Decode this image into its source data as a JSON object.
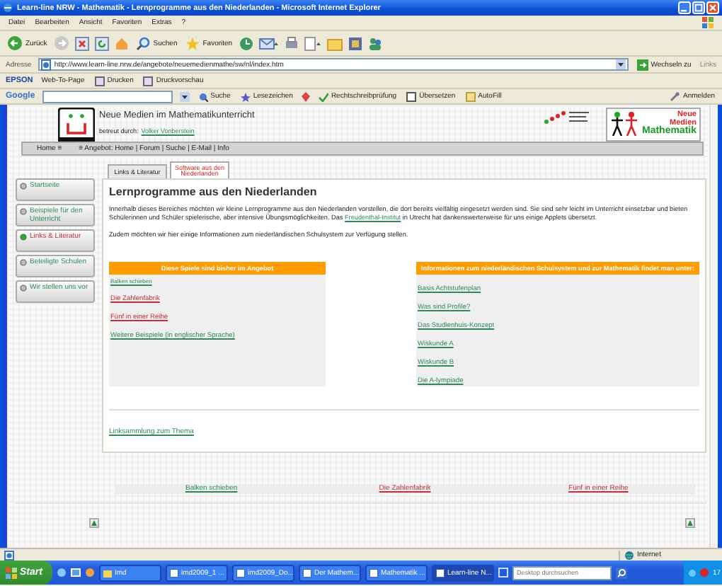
{
  "window": {
    "title": "Learn-line NRW - Mathematik - Lernprogramme aus den Niederlanden - Microsoft Internet Explorer"
  },
  "menu": [
    "Datei",
    "Bearbeiten",
    "Ansicht",
    "Favoriten",
    "Extras",
    "?"
  ],
  "toolbar": [
    "Zurück",
    "Suchen",
    "Favoriten"
  ],
  "address_bar": {
    "label": "Adresse",
    "value": "http://www.learn-line.nrw.de/angebote/neuemedienmathe/sw/nl/index.htm",
    "go": "Wechseln zu",
    "links": "Links"
  },
  "epson_bar": {
    "brand": "EPSON",
    "items": [
      "Web-To-Page",
      "Drucken",
      "Druckvorschau"
    ]
  },
  "google_bar": {
    "brand": "Google",
    "items": [
      "Suche",
      "Lesezeichen",
      "Rechtschreibprüfung",
      "Übersetzen",
      "AutoFill",
      "Anmelden"
    ]
  },
  "page": {
    "site_title": "Neue Medien im Mathematikunterricht",
    "byline_label": "betreut durch:",
    "byline_link": "Volker Vonberstein",
    "nav_home": "Home ≡",
    "breadcrumb": "≡ Angebot: Home | Forum | Suche | E-Mail | Info",
    "logo_words": [
      "Neue",
      "Medien",
      "Mathematik"
    ],
    "tabs": [
      {
        "label": "Links & Literatur",
        "selected": false
      },
      {
        "label": "Software aus den Niederlanden",
        "selected": true
      }
    ],
    "sidebar": [
      {
        "label": "Startseite",
        "selected": false
      },
      {
        "label": "Beispiele für den Unterricht",
        "selected": false
      },
      {
        "label": "Links & Literatur",
        "selected": true
      },
      {
        "label": "Beteiligte Schulen",
        "selected": false
      },
      {
        "label": "Wir stellen uns vor",
        "selected": false
      }
    ],
    "heading": "Lernprogramme aus den Niederlanden",
    "intro": {
      "before": "Innerhalb dieses Bereiches möchten wir kleine Lernprogramme aus den Niederlanden vorstellen, die dort bereits vielfältig eingesetzt werden sind. Sie sind sehr leicht im Unterricht einsetzbar und bieten Schülerinnen und Schüler spielerische, aber intensive Übungsmöglichkeiten. Das",
      "link": "Freudenthal-Institut",
      "after": "in Utrecht hat dankenswerterweise für uns einige Applets übersetzt."
    },
    "note": "Zudem möchten wir hier einige Informationen zum niederländischen Schulsystem zur Verfügung stellen.",
    "columns": [
      {
        "header": "Diese Spiele sind bisher im Angebot",
        "links": [
          {
            "label": "Balken schieben",
            "visited": false
          },
          {
            "label": "Die Zahlenfabrik",
            "visited": true
          },
          {
            "label": "Fünf in einer Reihe",
            "visited": true
          },
          {
            "label": "Weitere Beispiele (in englischer Sprache)",
            "visited": false
          }
        ]
      },
      {
        "header": "Informationen zum niederländischen Schulsystem und zur Mathematik findet man unter:",
        "links": [
          {
            "label": "Basis Achtstufenplan",
            "visited": false
          },
          {
            "label": "Was sind Profile?",
            "visited": false
          },
          {
            "label": "Das Studienhuis-Konzept",
            "visited": false
          },
          {
            "label": "Wiskunde A",
            "visited": false
          },
          {
            "label": "Wiskunde B",
            "visited": false
          },
          {
            "label": "Die A-lympiade",
            "visited": false
          }
        ]
      }
    ],
    "link_collection": "Linksammlung zum Thema",
    "footer_links": [
      {
        "label": "Balken schieben",
        "visited": false
      },
      {
        "label": "Die Zahlenfabrik",
        "visited": true
      },
      {
        "label": "Fünf in einer Reihe",
        "visited": true
      }
    ]
  },
  "status_bar": {
    "zone": "Internet"
  },
  "taskbar": {
    "start": "Start",
    "tasks": [
      {
        "label": "Imd",
        "selected": false
      },
      {
        "label": "imd2009_1 ...",
        "selected": false
      },
      {
        "label": "imd2009_Do...",
        "selected": false
      },
      {
        "label": "Der Mathem...",
        "selected": false
      },
      {
        "label": "Mathematik ...",
        "selected": false
      },
      {
        "label": "Learn-line N...",
        "selected": true
      }
    ],
    "search_placeholder": "Desktop durchsuchen",
    "clock": "17"
  }
}
